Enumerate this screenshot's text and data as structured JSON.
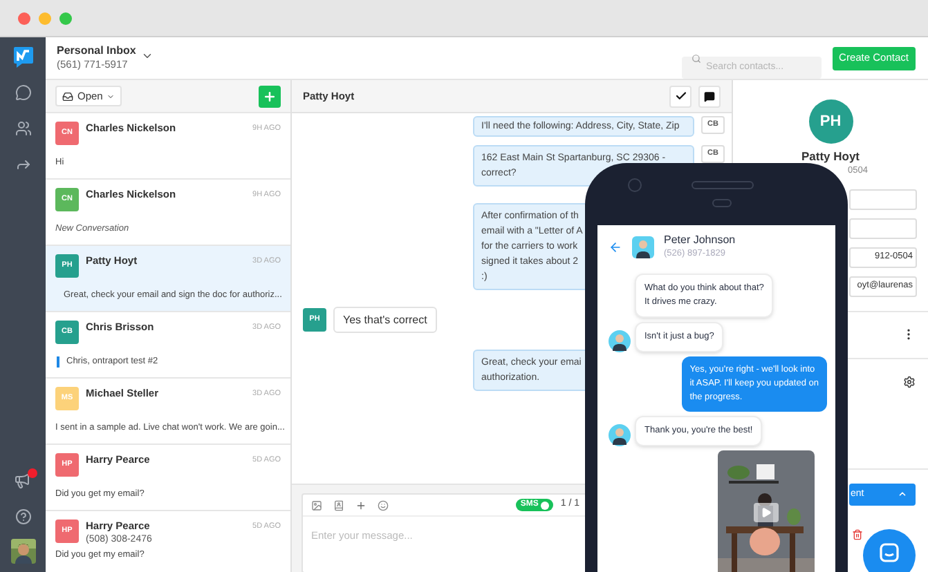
{
  "inbox": {
    "title": "Personal Inbox",
    "phone": "(561) 771-5917"
  },
  "search": {
    "placeholder": "Search contacts..."
  },
  "create_button": "Create Contact",
  "filter": {
    "label": "Open"
  },
  "conversations": [
    {
      "initials": "CN",
      "color": "#ef6a70",
      "name": "Charles Nickelson",
      "time": "9H AGO",
      "preview": "Hi",
      "kind": "plain",
      "selected": false
    },
    {
      "initials": "CN",
      "color": "#5cb85c",
      "name": "Charles Nickelson",
      "time": "9H AGO",
      "preview": "New Conversation",
      "kind": "italic",
      "selected": false
    },
    {
      "initials": "PH",
      "color": "#26a08e",
      "name": "Patty Hoyt",
      "time": "3D AGO",
      "preview": "Great, check your email and sign the doc for authoriz...",
      "kind": "note",
      "selected": true
    },
    {
      "initials": "CB",
      "color": "#26a08e",
      "name": "Chris Brisson",
      "time": "3D AGO",
      "preview": "Chris, ontraport test #2",
      "kind": "note",
      "selected": false
    },
    {
      "initials": "MS",
      "color": "#fcd27a",
      "name": "Michael Steller",
      "time": "3D AGO",
      "preview": "I sent in a sample ad. Live chat won't work. We are goin...",
      "kind": "plain",
      "selected": false
    },
    {
      "initials": "HP",
      "color": "#ef6a70",
      "name": "Harry Pearce",
      "time": "5D AGO",
      "preview": "Did you get my email?",
      "kind": "plain",
      "selected": false
    },
    {
      "initials": "HP",
      "color": "#ef6a70",
      "name": "Harry Pearce",
      "phone": "(508) 308-2476",
      "time": "5D AGO",
      "preview": "Did you get my email?",
      "kind": "plain",
      "selected": false
    }
  ],
  "chat": {
    "title": "Patty Hoyt",
    "messages": [
      {
        "kind": "outgoing",
        "avatar": "CB",
        "lines": [
          "I'll need the following: Address, City, State, Zip"
        ]
      },
      {
        "kind": "outgoing",
        "avatar": "CB",
        "lines": [
          "162 East Main St Spartanburg, SC 29306 -",
          "correct?"
        ]
      },
      {
        "kind": "outgoing",
        "lines": [
          "After confirmation of th",
          "email with a \"Letter of A",
          "for the carriers to work",
          "signed it takes about 2",
          ":)"
        ]
      },
      {
        "kind": "incoming",
        "avatar": "PH",
        "lines": [
          "Yes that's correct"
        ]
      },
      {
        "kind": "outgoing",
        "lines": [
          "Great, check your emai",
          "authorization."
        ]
      }
    ]
  },
  "composer": {
    "sms_label": "SMS",
    "sms_on": true,
    "counter": "1 / 1",
    "placeholder": "Enter your message..."
  },
  "phone": {
    "contact": {
      "name": "Peter Johnson",
      "phone": "(526) 897-1829"
    },
    "messages": [
      {
        "kind": "incoming",
        "avatar": false,
        "lines": [
          "What do you think about that?",
          "It drives me crazy."
        ]
      },
      {
        "kind": "incoming",
        "avatar": true,
        "lines": [
          "Isn't it just a bug?"
        ]
      },
      {
        "kind": "outgoing",
        "lines": [
          "Yes, you're right - we'll look into",
          "it ASAP. I'll keep you updated on",
          "the progress."
        ]
      },
      {
        "kind": "incoming",
        "avatar": true,
        "lines": [
          "Thank you, you're the best!"
        ]
      },
      {
        "kind": "video"
      }
    ]
  },
  "contact_panel": {
    "initials": "PH",
    "name": "Patty Hoyt",
    "phone": "0504",
    "fields": [
      {
        "kind": "empty"
      },
      {
        "kind": "empty"
      },
      {
        "kind": "text",
        "value": "912-0504"
      },
      {
        "kind": "text",
        "value": "oyt@laurenas"
      }
    ],
    "action_button": "ent"
  }
}
